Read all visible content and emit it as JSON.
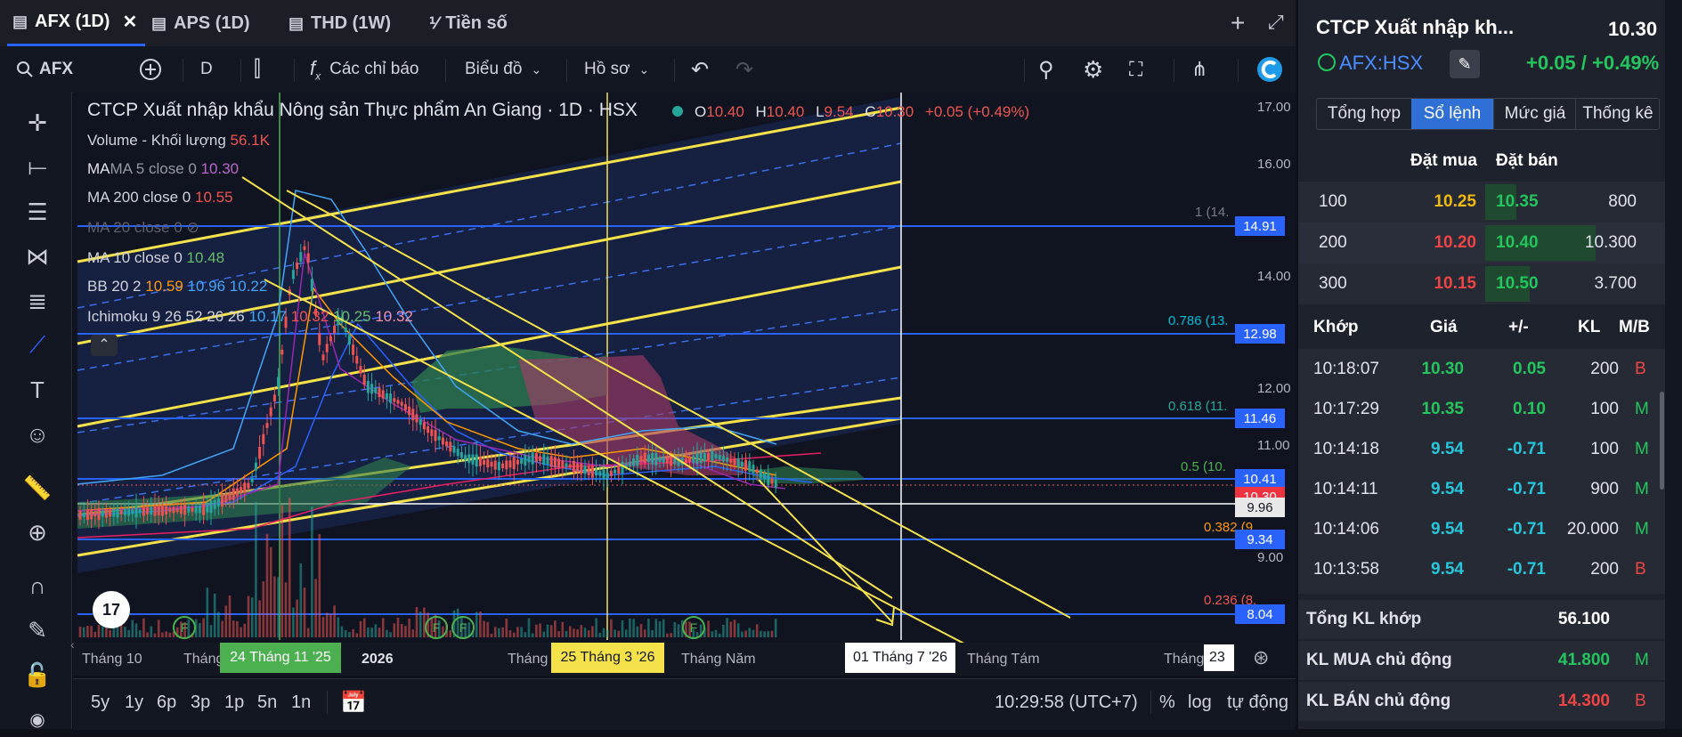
{
  "tabs": [
    {
      "label": "AFX (1D)",
      "active": true
    },
    {
      "label": "APS (1D)",
      "active": false
    },
    {
      "label": "THD (1W)",
      "active": false
    },
    {
      "label": "Tiền số",
      "active": false
    }
  ],
  "toolbar": {
    "symbol": "AFX",
    "interval": "D",
    "indicators_label": "Các chỉ báo",
    "chart_label": "Biểu đồ",
    "profile_label": "Hồ sơ"
  },
  "legend": {
    "title": "CTCP Xuất nhập khẩu Nông sản Thực phẩm An Giang · 1D · HSX",
    "o_label": "O",
    "o_val": "10.40",
    "h_label": "H",
    "h_val": "10.40",
    "l_label": "L",
    "l_val": "9.54",
    "c_label": "C",
    "c_val": "10.30",
    "change": "+0.05 (+0.49%)",
    "volume_label": "Volume - Khối lượng",
    "volume_val": "56.1K",
    "ma5_label": "MA 5 close 0",
    "ma5_val": "10.30",
    "ma200_label": "MA 200 close 0",
    "ma200_val": "10.55",
    "ma20_label": "MA 20 close 0",
    "ma10_label": "MA 10 close 0",
    "ma10_val": "10.48",
    "bb_label": "BB 20 2",
    "bb_v1": "10.59",
    "bb_v2": "10.96",
    "bb_v3": "10.22",
    "ichi_label": "Ichimoku 9 26 52 26 26",
    "ichi_v1": "10.17",
    "ichi_v2": "10.32",
    "ichi_v3": "10.25",
    "ichi_v4": "10.32"
  },
  "price_axis": [
    "17.00",
    "16.00",
    "14.00",
    "12.00",
    "11.00",
    "9.00"
  ],
  "price_tags": {
    "t1": "14.91",
    "t2": "12.98",
    "t3": "11.46",
    "t4": "10.41",
    "t5": "10.30",
    "t6": "9.96",
    "t7": "9.34",
    "t8": "8.04"
  },
  "fib_labels": {
    "f1": "1 (14.",
    "f2": "0.786 (13.",
    "f3": "0.618 (11.",
    "f4": "0.5 (10.",
    "f5": "0.382 (9.",
    "f6": "0.236 (8."
  },
  "time_axis": {
    "t1": "Tháng 10",
    "t2": "Tháng",
    "t3": "2026",
    "t4": "Tháng",
    "t5": "Tháng Năm",
    "t6": "Tháng Tám",
    "t7": "Tháng",
    "t8": "23"
  },
  "time_tags": {
    "g": "24 Tháng 11 '25",
    "y": "25 Tháng 3 '26",
    "w": "01 Tháng 7 '26"
  },
  "marker_letter": "F",
  "bottom": {
    "ranges": [
      "5y",
      "1y",
      "6p",
      "3p",
      "1p",
      "5n",
      "1n"
    ],
    "time": "10:29:58 (UTC+7)",
    "pct": "%",
    "log": "log",
    "auto": "tự động"
  },
  "right": {
    "company": "CTCP Xuất nhập kh...",
    "price": "10.30",
    "ticker": "AFX:HSX",
    "change": "+0.05 / +0.49%",
    "tabs": [
      "Tổng hợp",
      "Sổ lệnh",
      "Mức giá",
      "Thống kê"
    ],
    "ob_headers": {
      "buy": "Đặt mua",
      "sell": "Đặt bán"
    },
    "orderbook": [
      {
        "bvol": "100",
        "bprice": "10.25",
        "sprice": "10.35",
        "svol": "800"
      },
      {
        "bvol": "200",
        "bprice": "10.20",
        "sprice": "10.40",
        "svol": "10.300"
      },
      {
        "bvol": "300",
        "bprice": "10.15",
        "sprice": "10.50",
        "svol": "3.700"
      }
    ],
    "trade_headers": [
      "Khớp",
      "Giá",
      "+/-",
      "KL",
      "M/B"
    ],
    "trades": [
      {
        "time": "10:18:07",
        "price": "10.30",
        "chg": "0.05",
        "vol": "200",
        "side": "B"
      },
      {
        "time": "10:17:29",
        "price": "10.35",
        "chg": "0.10",
        "vol": "100",
        "side": "M"
      },
      {
        "time": "10:14:18",
        "price": "9.54",
        "chg": "-0.71",
        "vol": "100",
        "side": "M"
      },
      {
        "time": "10:14:11",
        "price": "9.54",
        "chg": "-0.71",
        "vol": "900",
        "side": "M"
      },
      {
        "time": "10:14:06",
        "price": "9.54",
        "chg": "-0.71",
        "vol": "20.000",
        "side": "M"
      },
      {
        "time": "10:13:58",
        "price": "9.54",
        "chg": "-0.71",
        "vol": "200",
        "side": "B"
      }
    ],
    "summary": [
      {
        "label": "Tổng KL khớp",
        "value": "56.100",
        "side": ""
      },
      {
        "label": "KL MUA chủ động",
        "value": "41.800",
        "side": "M"
      },
      {
        "label": "KL BÁN chủ động",
        "value": "14.300",
        "side": "B"
      }
    ]
  },
  "colors": {
    "accent": "#2962ff",
    "up": "#26a69a",
    "down": "#ef5350",
    "trend": "#f5e24b",
    "green_text": "#22c55e",
    "red_text": "#ef4444"
  }
}
